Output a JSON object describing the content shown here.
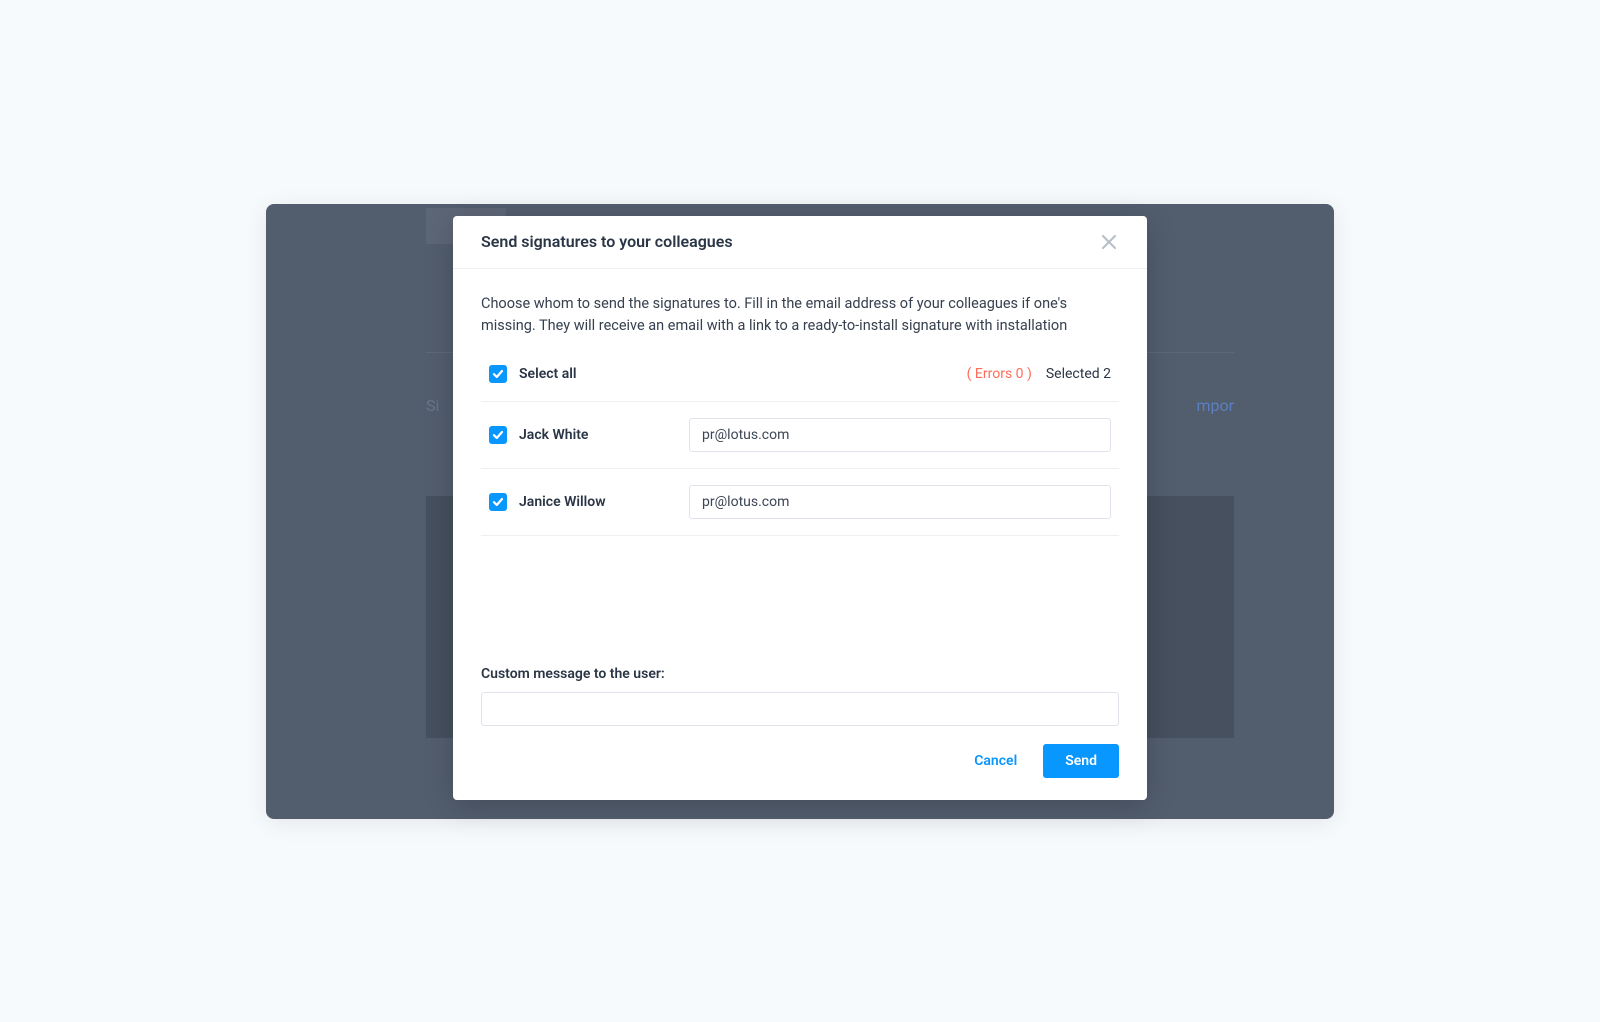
{
  "modal": {
    "title": "Send signatures to your colleagues",
    "description": "Choose whom to send the signatures to. Fill in the email address of your colleagues if one's missing. They will receive an email with a link to a ready-to-install signature with installation",
    "select_all_label": "Select all",
    "errors_text": "( Errors 0 )",
    "selected_text": "Selected 2",
    "users": [
      {
        "name": "Jack White",
        "email": "pr@lotus.com",
        "checked": true
      },
      {
        "name": "Janice Willow",
        "email": "pr@lotus.com",
        "checked": true
      }
    ],
    "custom_message_label": "Custom message to the user:",
    "custom_message_value": "",
    "cancel_label": "Cancel",
    "send_label": "Send"
  },
  "background": {
    "left_hint": "Si",
    "right_hint": "mpor"
  },
  "colors": {
    "accent": "#0896ff",
    "error": "#ff6b5b",
    "backdrop": "#525d6e"
  }
}
